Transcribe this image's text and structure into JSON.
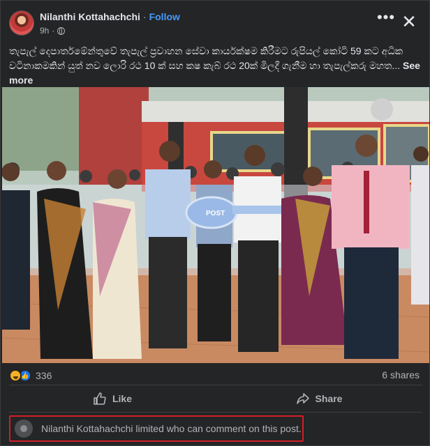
{
  "post": {
    "author": "Nilanthi Kottahachchi",
    "follow_label": "Follow",
    "time": "9h",
    "privacy_icon": "globe-icon",
    "text": "තැපැල් දෙපාර්තමේන්තුවේ තැපැල් ප්‍රවාහන සේවා කාර්යක්ෂම කිරීමට රුපියල් කෝටි  59 කට අධික වටිනාකමකින් යුත් නව ලොරි  රථ 10 ක් සහ කෂ කැබ් රථ 20ක් මිලදී ගැනීම හා තැපැල්කරු මහත...",
    "see_more": "See more",
    "image_caption_on_key": "POST"
  },
  "header_actions": {
    "more_icon": "more-horizontal-icon",
    "close_icon": "close-icon"
  },
  "engagement": {
    "reaction_icons": [
      "haha-icon",
      "like-icon"
    ],
    "reaction_count": "336",
    "shares": "6 shares"
  },
  "actions": {
    "like_label": "Like",
    "share_label": "Share"
  },
  "comment_notice": {
    "text": "Nilanthi Kottahachchi limited who can comment on this post."
  },
  "colors": {
    "background": "#242526",
    "accent": "#4599ff",
    "notice_border": "#d21f26"
  }
}
